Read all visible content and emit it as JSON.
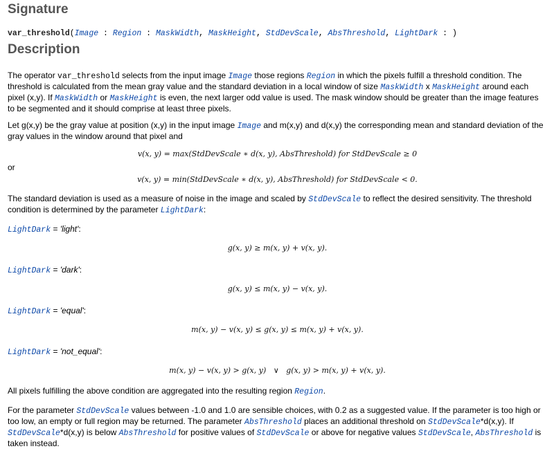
{
  "signature_heading": "Signature",
  "signature": {
    "operator": "var_threshold",
    "open": "(",
    "params_in": [
      "Image"
    ],
    "sep1": " : ",
    "params_out": [
      "Region"
    ],
    "sep2": " : ",
    "params_ctrl": [
      "MaskWidth",
      "MaskHeight",
      "StdDevScale",
      "AbsThreshold",
      "LightDark"
    ],
    "close": " : )"
  },
  "description_heading": "Description",
  "para1": {
    "t1": "The operator ",
    "op": "var_threshold",
    "t2": " selects from the input image ",
    "p1": "Image",
    "t3": " those regions ",
    "p2": "Region",
    "t4": " in which the pixels fulfill a threshold condition. The threshold is calculated from the mean gray value and the standard deviation in a local window of size ",
    "p3": "MaskWidth",
    "t5": " x ",
    "p4": "MaskHeight",
    "t6": " around each pixel (x,y). If ",
    "p5": "MaskWidth",
    "t7": " or ",
    "p6": "MaskHeight",
    "t8": " is even, the next larger odd value is used. The mask window should be greater than the image features to be segmented and it should comprise at least three pixels."
  },
  "para2": {
    "t1": "Let g(x,y) be the gray value at position (x,y) in the input image ",
    "p1": "Image",
    "t2": " and m(x,y) and d(x,y) the corresponding mean and standard deviation of the gray values in the window around that pixel and"
  },
  "eq1": "v(x, y) = max(StdDevScale ∗ d(x, y), AbsThreshold) for StdDevScale ≥ 0",
  "or_text": "or",
  "eq2": "v(x, y) = min(StdDevScale ∗ d(x, y), AbsThreshold) for StdDevScale < 0.",
  "para3": {
    "t1": "The standard deviation is used as a measure of noise in the image and scaled by ",
    "p1": "StdDevScale",
    "t2": " to reflect the desired sensitivity. The threshold condition is determined by the parameter ",
    "p2": "LightDark",
    "t3": ":"
  },
  "conditions": [
    {
      "param": "LightDark",
      "eq_sign": " = ",
      "value": "'light'",
      "colon": ":",
      "formula": "g(x, y) ≥ m(x, y) + v(x, y)."
    },
    {
      "param": "LightDark",
      "eq_sign": " = ",
      "value": "'dark'",
      "colon": ":",
      "formula": "g(x, y) ≤ m(x, y) − v(x, y)."
    },
    {
      "param": "LightDark",
      "eq_sign": " = ",
      "value": "'equal'",
      "colon": ":",
      "formula": "m(x, y) − v(x, y) ≤ g(x, y) ≤ m(x, y) + v(x, y)."
    },
    {
      "param": "LightDark",
      "eq_sign": " = ",
      "value": "'not_equal'",
      "colon": ":",
      "formula": "m(x, y) − v(x, y) > g(x, y)   ∨   g(x, y) > m(x, y) + v(x, y)."
    }
  ],
  "para4": {
    "t1": "All pixels fulfilling the above condition are aggregated into the resulting region ",
    "p1": "Region",
    "t2": "."
  },
  "para5": {
    "t1": "For the parameter ",
    "p1": "StdDevScale",
    "t2": " values between -1.0 and 1.0 are sensible choices, with 0.2 as a suggested value. If the parameter is too high or too low, an empty or full region may be returned. The parameter ",
    "p2": "AbsThreshold",
    "t3": " places an additional threshold on ",
    "p3": "StdDevScale",
    "t4": "*d(x,y). If ",
    "p4": "StdDevScale",
    "t5": "*d(x,y) is below ",
    "p5": "AbsThreshold",
    "t6": " for positive values of ",
    "p6": "StdDevScale",
    "t7": " or above for negative values ",
    "p7": "StdDevScale",
    "t8": ", ",
    "p8": "AbsThreshold",
    "t9": " is taken instead."
  },
  "colors": {
    "parameter_link": "#0c48a8",
    "heading": "#555555"
  }
}
